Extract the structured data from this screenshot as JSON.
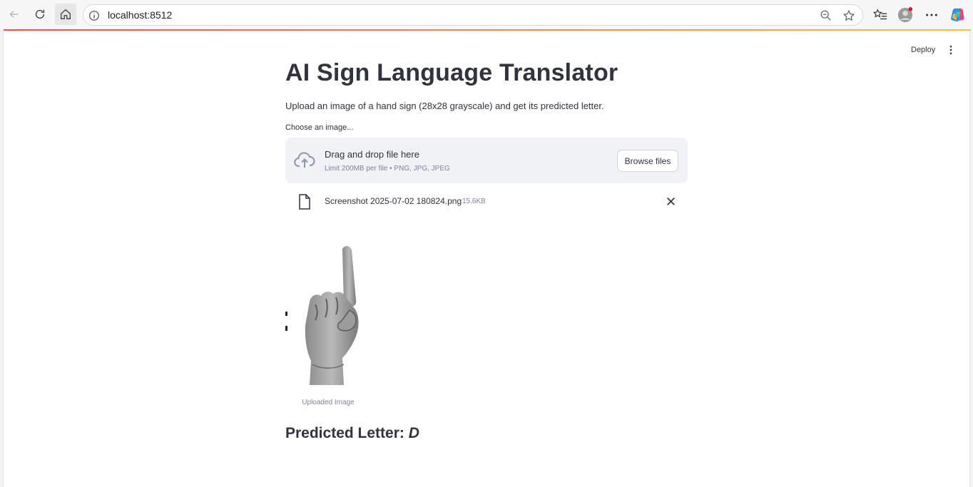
{
  "browser": {
    "url": "localhost:8512",
    "icons": {
      "back": "back-arrow-icon",
      "reload": "reload-icon",
      "home": "home-icon",
      "site_info": "info-icon",
      "zoom": "zoom-out-icon",
      "favorite": "star-icon",
      "favorites_list": "favorites-icon",
      "profile": "profile-avatar-icon",
      "more": "more-options-icon",
      "copilot": "copilot-icon"
    }
  },
  "app": {
    "header": {
      "deploy_label": "Deploy"
    },
    "title": "AI Sign Language Translator",
    "subtitle": "Upload an image of a hand sign (28x28 grayscale) and get its predicted letter.",
    "uploader": {
      "label": "Choose an image...",
      "drop_title": "Drag and drop file here",
      "drop_limit": "Limit 200MB per file • PNG, JPG, JPEG",
      "browse_label": "Browse files"
    },
    "file": {
      "name": "Screenshot 2025-07-02 180824.png",
      "size": "15.6KB"
    },
    "image": {
      "caption": "Uploaded Image"
    },
    "prediction": {
      "prefix": "Predicted Letter: ",
      "letter": "D"
    }
  },
  "colors": {
    "text": "#31333f",
    "muted": "#808495",
    "dropzone_bg": "#f0f2f6",
    "accent_start": "#ff4b4b",
    "accent_end": "#ffbd45"
  }
}
